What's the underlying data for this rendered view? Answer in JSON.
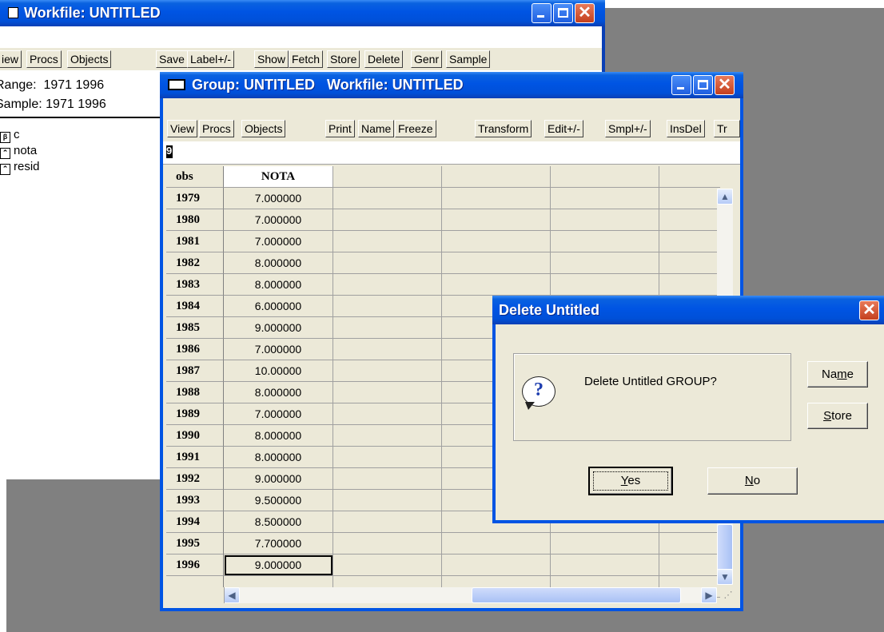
{
  "workfile": {
    "title": "Workfile: UNTITLED",
    "toolbar": [
      "iew",
      "Procs",
      "Objects",
      "Save",
      "Label+/-",
      "Show",
      "Fetch",
      "Store",
      "Delete",
      "Genr",
      "Sample"
    ],
    "range_label": "Range:",
    "range_value": "1971 1996",
    "sample_label": "Sample:",
    "sample_value": "1971 1996",
    "objects": [
      {
        "name": "c",
        "icon": "coef-icon"
      },
      {
        "name": "nota",
        "icon": "series-icon"
      },
      {
        "name": "resid",
        "icon": "series-icon"
      }
    ]
  },
  "group": {
    "title": "Group: UNTITLED   Workfile: UNTITLED",
    "toolbar": [
      "View",
      "Procs",
      "Objects",
      "Print",
      "Name",
      "Freeze",
      "Transform",
      "Edit+/-",
      "Smpl+/-",
      "InsDel",
      "Tr"
    ],
    "edit_value": "9",
    "headers": [
      "obs",
      "NOTA"
    ],
    "rows": [
      {
        "obs": "1979",
        "nota": "7.000000"
      },
      {
        "obs": "1980",
        "nota": "7.000000"
      },
      {
        "obs": "1981",
        "nota": "7.000000"
      },
      {
        "obs": "1982",
        "nota": "8.000000"
      },
      {
        "obs": "1983",
        "nota": "8.000000"
      },
      {
        "obs": "1984",
        "nota": "6.000000"
      },
      {
        "obs": "1985",
        "nota": "9.000000"
      },
      {
        "obs": "1986",
        "nota": "7.000000"
      },
      {
        "obs": "1987",
        "nota": "10.00000"
      },
      {
        "obs": "1988",
        "nota": "8.000000"
      },
      {
        "obs": "1989",
        "nota": "7.000000"
      },
      {
        "obs": "1990",
        "nota": "8.000000"
      },
      {
        "obs": "1991",
        "nota": "8.000000"
      },
      {
        "obs": "1992",
        "nota": "9.000000"
      },
      {
        "obs": "1993",
        "nota": "9.500000"
      },
      {
        "obs": "1994",
        "nota": "8.500000"
      },
      {
        "obs": "1995",
        "nota": "7.700000"
      },
      {
        "obs": "1996",
        "nota": "9.000000"
      }
    ]
  },
  "dialog": {
    "title": "Delete Untitled",
    "message": "Delete Untitled GROUP?",
    "buttons": {
      "yes_prefix": "",
      "yes_key": "Y",
      "yes_rest": "es",
      "no_prefix": "",
      "no_key": "N",
      "no_rest": "o",
      "name_prefix": "Na",
      "name_key": "m",
      "name_rest": "e",
      "store_prefix": "",
      "store_key": "S",
      "store_rest": "tore"
    }
  }
}
